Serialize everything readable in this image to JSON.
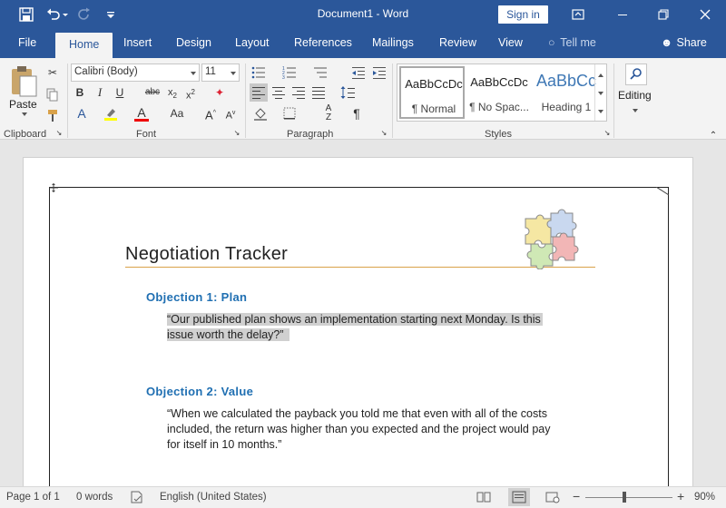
{
  "titlebar": {
    "title": "Document1 - Word",
    "signin_label": "Sign in"
  },
  "menu": {
    "file": "File",
    "tabs": [
      "Home",
      "Insert",
      "Design",
      "Layout",
      "References",
      "Mailings",
      "Review",
      "View"
    ],
    "tell_me": "Tell me",
    "share": "Share"
  },
  "ribbon": {
    "clipboard": {
      "label": "Clipboard",
      "paste": "Paste"
    },
    "font": {
      "label": "Font",
      "name": "Calibri (Body)",
      "size": "11"
    },
    "paragraph": {
      "label": "Paragraph"
    },
    "styles": {
      "label": "Styles",
      "items": [
        {
          "preview": "AaBbCcDc",
          "name": "¶ Normal"
        },
        {
          "preview": "AaBbCcDc",
          "name": "¶ No Spac..."
        },
        {
          "preview": "AaBbCc",
          "name": "Heading 1"
        }
      ]
    },
    "editing": {
      "label": "Editing"
    }
  },
  "document": {
    "title": "Negotiation Tracker",
    "objection1": {
      "heading": "Objection 1: Plan",
      "line1": "“Our published plan shows an implementation starting next Monday. Is this",
      "line2": "issue worth the delay?”"
    },
    "objection2": {
      "heading": "Objection 2: Value",
      "line1": "“When we calculated the payback you told me that even with all of the costs",
      "line2": "included, the return was higher than you expected and the project would pay",
      "line3": "for itself in 10 months.”"
    }
  },
  "statusbar": {
    "page": "Page 1 of 1",
    "words": "0 words",
    "language": "English (United States)",
    "zoom": "90%",
    "zoom_value": 90
  },
  "colors": {
    "title_bar": "#2b579a",
    "heading": "#1f6fb2",
    "accent_rule": "#d9a24a",
    "highlight": "#d0d0d0"
  }
}
